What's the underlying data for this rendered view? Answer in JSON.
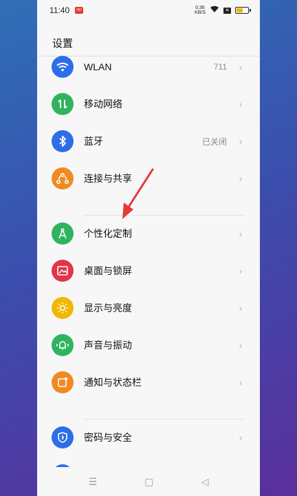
{
  "status": {
    "time": "11:40",
    "app_badge": "HD",
    "net_speed_top": "0.36",
    "net_speed_bottom": "KB/S",
    "sim": "✕"
  },
  "header": {
    "title": "设置"
  },
  "items": [
    {
      "label": "WLAN",
      "value": "711",
      "icon": "wifi-icon",
      "color": "#2d6ee8"
    },
    {
      "label": "移动网络",
      "value": "",
      "icon": "mobile-data-icon",
      "color": "#2fb35f"
    },
    {
      "label": "蓝牙",
      "value": "已关闭",
      "icon": "bluetooth-icon",
      "color": "#2d6ee8"
    },
    {
      "label": "连接与共享",
      "value": "",
      "icon": "share-icon",
      "color": "#f08a24"
    },
    {
      "label": "个性化定制",
      "value": "",
      "icon": "personalize-icon",
      "color": "#2fb35f"
    },
    {
      "label": "桌面与锁屏",
      "value": "",
      "icon": "wallpaper-icon",
      "color": "#e0364a"
    },
    {
      "label": "显示与亮度",
      "value": "",
      "icon": "brightness-icon",
      "color": "#f2b705"
    },
    {
      "label": "声音与振动",
      "value": "",
      "icon": "bell-icon",
      "color": "#2fb35f"
    },
    {
      "label": "通知与状态栏",
      "value": "",
      "icon": "notification-icon",
      "color": "#f08a24"
    },
    {
      "label": "密码与安全",
      "value": "",
      "icon": "shield-icon",
      "color": "#2d6ee8"
    }
  ],
  "nav": {
    "menu": "☰",
    "home": "▢",
    "back": "◁"
  }
}
